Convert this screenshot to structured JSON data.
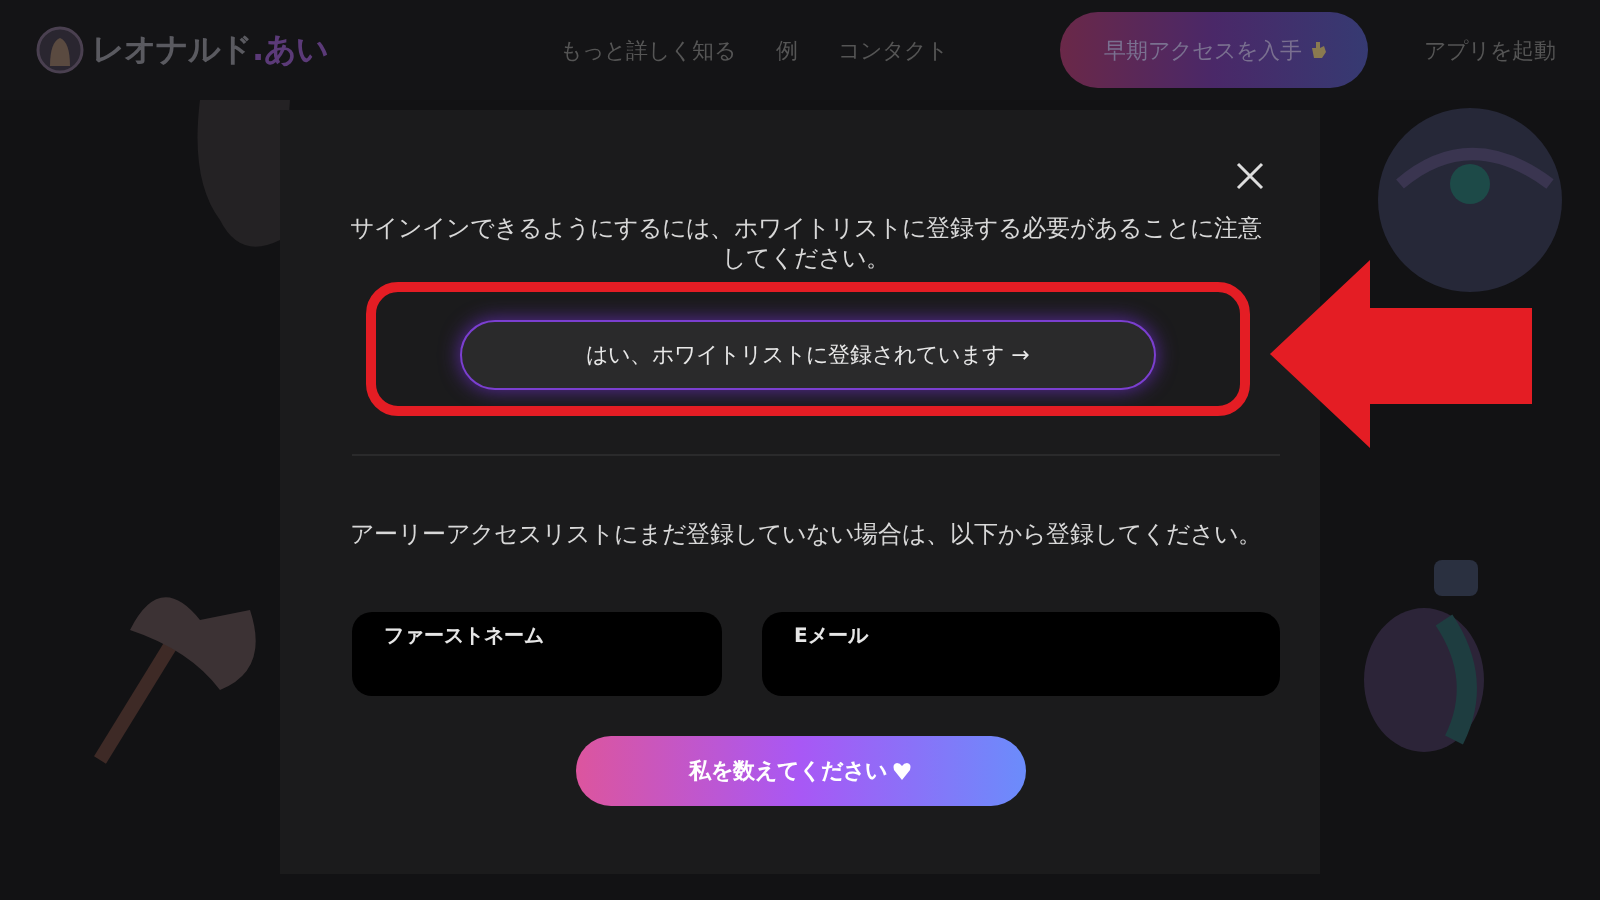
{
  "header": {
    "brand": "レオナルド",
    "brand_suffix": ".あい",
    "nav": [
      "もっと詳しく知る",
      "例",
      "コンタクト"
    ],
    "cta": "早期アクセスを入手",
    "launch": "アプリを起動"
  },
  "modal": {
    "notice": "サインインできるようにするには、ホワイトリストに登録する必要があることに注意してください。",
    "whitelist_button": "はい、ホワイトリストに登録されています →",
    "signup_text": "アーリーアクセスリストにまだ登録していない場合は、以下から登録してください。",
    "fields": [
      {
        "placeholder": "ファーストネーム"
      },
      {
        "placeholder": "Eメール"
      }
    ],
    "submit": "私を数えてください"
  },
  "annotation": {
    "highlight_box": true,
    "arrow": true
  }
}
